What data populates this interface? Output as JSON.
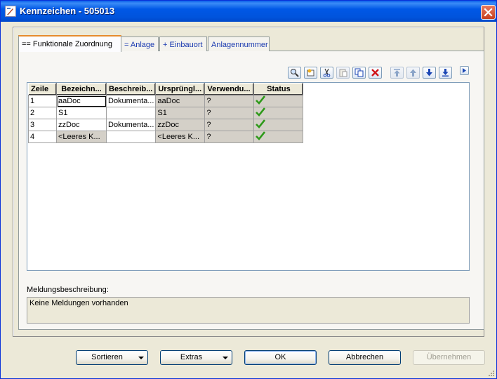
{
  "window": {
    "title": "Kennzeichen - 505013"
  },
  "tabs": [
    {
      "label": "== Funktionale Zuordnung",
      "active": true
    },
    {
      "label": "= Anlage",
      "active": false
    },
    {
      "label": "+ Einbauort",
      "active": false
    },
    {
      "label": "Anlagennummer",
      "active": false
    }
  ],
  "toolbar": {
    "icons": [
      "find-icon",
      "new-icon",
      "cut-icon",
      "paste-icon",
      "copy-icon",
      "delete-icon",
      "move-top-icon",
      "move-up-icon",
      "move-down-icon",
      "move-bottom-icon",
      "expand-icon"
    ]
  },
  "grid": {
    "headers": [
      "Zeile",
      "Bezeichn...",
      "Beschreib...",
      "Ursprüngl...",
      "Verwendu...",
      "Status"
    ],
    "rows": [
      {
        "zeile": "1",
        "bez": "aaDoc",
        "beschr": "Dokumenta...",
        "urspr": "aaDoc",
        "verw": "?",
        "status": "ok"
      },
      {
        "zeile": "2",
        "bez": "S1",
        "beschr": "",
        "urspr": "S1",
        "verw": "?",
        "status": "ok"
      },
      {
        "zeile": "3",
        "bez": "zzDoc",
        "beschr": "Dokumenta...",
        "urspr": "zzDoc",
        "verw": "?",
        "status": "ok"
      },
      {
        "zeile": "4",
        "bez": "<Leeres K...",
        "beschr": "",
        "urspr": "<Leeres K...",
        "verw": "?",
        "status": "ok"
      }
    ]
  },
  "messages": {
    "label": "Meldungsbeschreibung:",
    "text": "Keine Meldungen vorhanden"
  },
  "buttons": {
    "sort": "Sortieren",
    "extras": "Extras",
    "ok": "OK",
    "cancel": "Abbrechen",
    "apply": "Übernehmen"
  },
  "colors": {
    "titlebar": "#0054E3",
    "status_ok": "#2E9A1A"
  }
}
